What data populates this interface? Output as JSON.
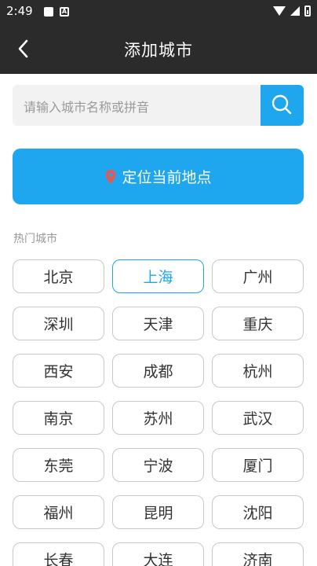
{
  "status_bar": {
    "time": "2:49"
  },
  "header": {
    "title": "添加城市"
  },
  "search": {
    "placeholder": "请输入城市名称或拼音"
  },
  "locate": {
    "label": "定位当前地点"
  },
  "hot_cities": {
    "title": "热门城市",
    "selected": "上海",
    "items": [
      "北京",
      "上海",
      "广州",
      "深圳",
      "天津",
      "重庆",
      "西安",
      "成都",
      "杭州",
      "南京",
      "苏州",
      "武汉",
      "东莞",
      "宁波",
      "厦门",
      "福州",
      "昆明",
      "沈阳",
      "长春",
      "大连",
      "济南"
    ]
  },
  "colors": {
    "accent": "#1ea7ee",
    "header_bg": "#2b2b2b"
  }
}
